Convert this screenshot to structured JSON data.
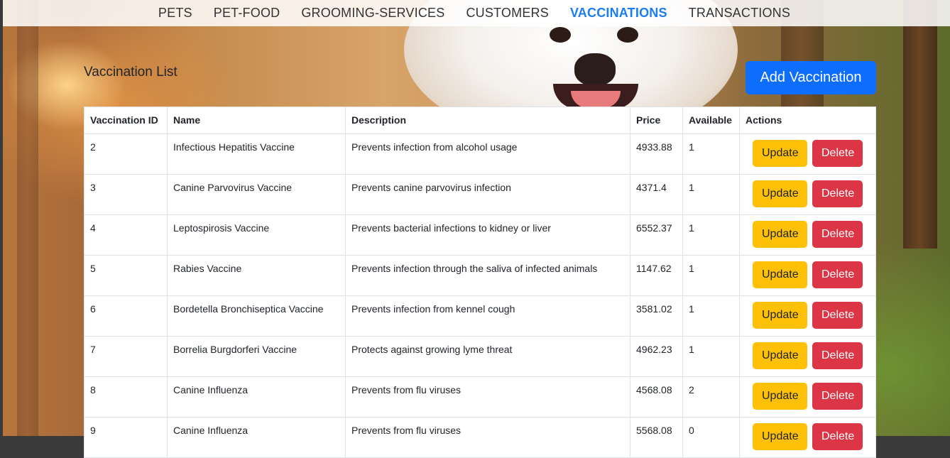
{
  "nav": {
    "items": [
      {
        "label": "PETS",
        "active": false
      },
      {
        "label": "PET-FOOD",
        "active": false
      },
      {
        "label": "GROOMING-SERVICES",
        "active": false
      },
      {
        "label": "CUSTOMERS",
        "active": false
      },
      {
        "label": "VACCINATIONS",
        "active": true
      },
      {
        "label": "TRANSACTIONS",
        "active": false
      }
    ],
    "active_color": "#1a7df2"
  },
  "page": {
    "title": "Vaccination List",
    "add_button_label": "Add Vaccination"
  },
  "table": {
    "headers": [
      "Vaccination ID",
      "Name",
      "Description",
      "Price",
      "Available",
      "Actions"
    ],
    "rows": [
      {
        "id": "2",
        "name": "Infectious Hepatitis Vaccine",
        "description": "Prevents infection from alcohol usage",
        "price": "4933.88",
        "available": "1"
      },
      {
        "id": "3",
        "name": "Canine Parvovirus Vaccine",
        "description": "Prevents canine parvovirus infection",
        "price": "4371.4",
        "available": "1"
      },
      {
        "id": "4",
        "name": "Leptospirosis Vaccine",
        "description": "Prevents bacterial infections to kidney or liver",
        "price": "6552.37",
        "available": "1"
      },
      {
        "id": "5",
        "name": "Rabies Vaccine",
        "description": "Prevents infection through the saliva of infected animals",
        "price": "1147.62",
        "available": "1"
      },
      {
        "id": "6",
        "name": "Bordetella Bronchiseptica Vaccine",
        "description": "Prevents infection from kennel cough",
        "price": "3581.02",
        "available": "1"
      },
      {
        "id": "7",
        "name": "Borrelia Burgdorferi Vaccine",
        "description": "Protects against growing lyme threat",
        "price": "4962.23",
        "available": "1"
      },
      {
        "id": "8",
        "name": "Canine Influenza",
        "description": "Prevents from flu viruses",
        "price": "4568.08",
        "available": "2"
      },
      {
        "id": "9",
        "name": "Canine Influenza",
        "description": "Prevents from flu viruses",
        "price": "5568.08",
        "available": "0"
      }
    ],
    "update_label": "Update",
    "delete_label": "Delete"
  },
  "colors": {
    "primary": "#0d6efd",
    "warning": "#ffc107",
    "danger": "#dc3545"
  }
}
